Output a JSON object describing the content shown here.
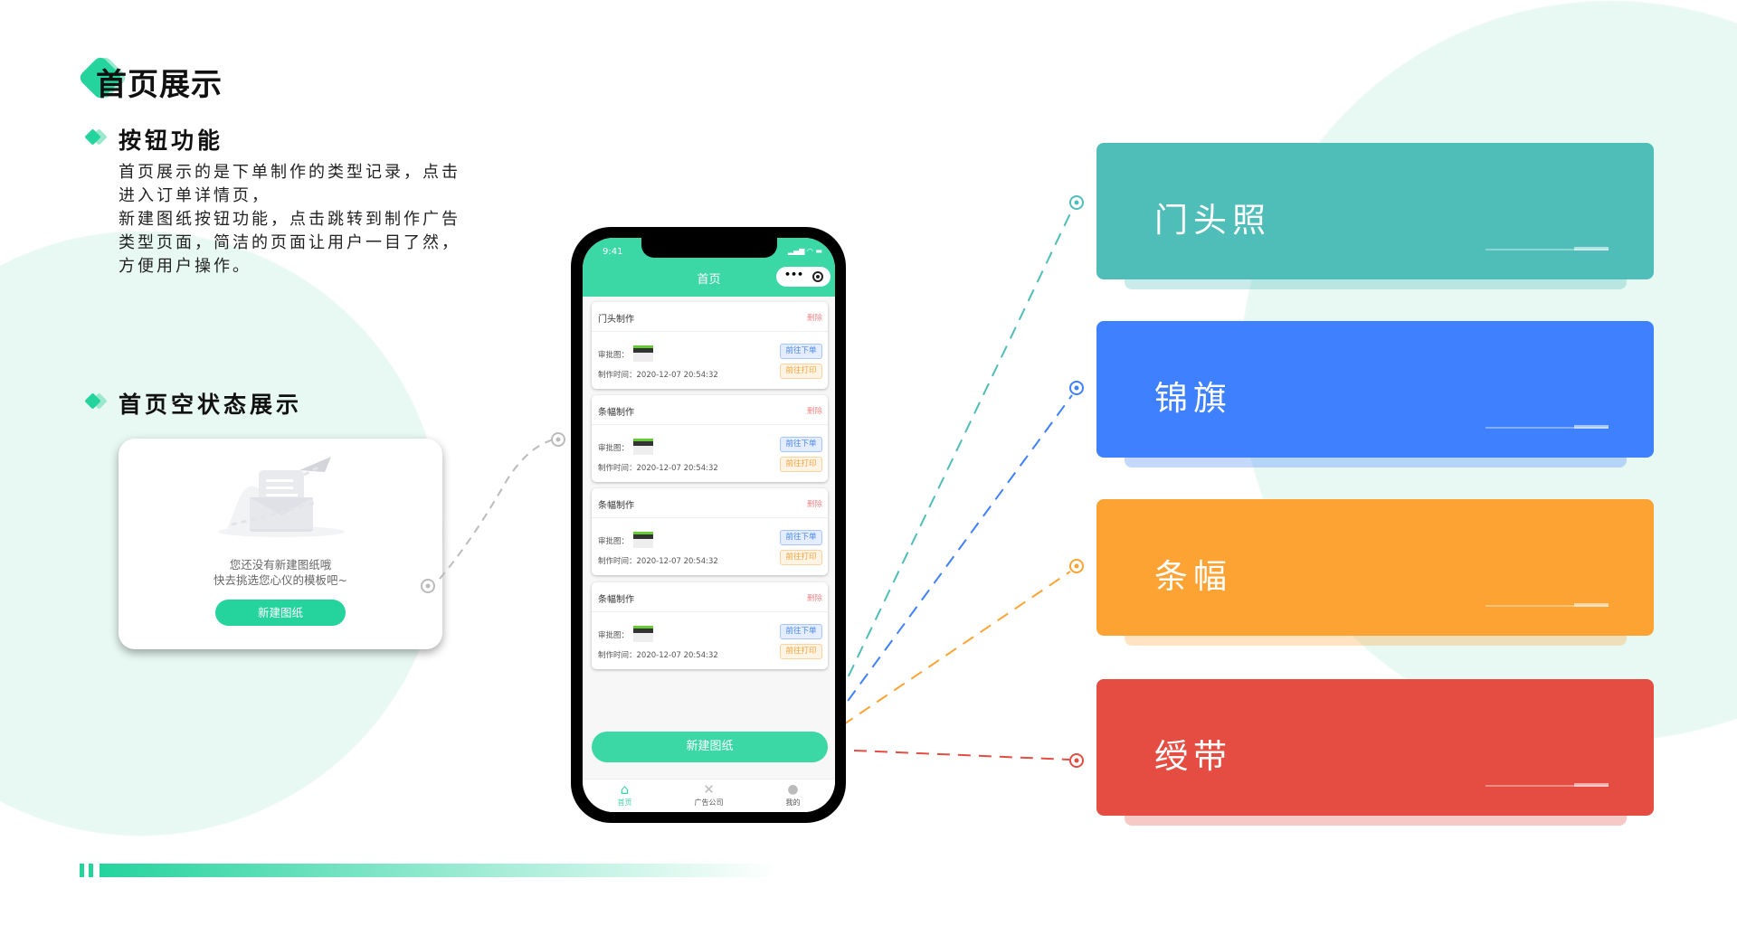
{
  "colors": {
    "accent": "#25d39d",
    "teal": "#4fbdb8",
    "blue": "#3f80fe",
    "orange": "#fca334",
    "red": "#e54c42"
  },
  "page_title": "首页展示",
  "section1": {
    "heading": "按钮功能",
    "paragraph": [
      "首页展示的是下单制作的类型记录，点击进入订单详情页，",
      "新建图纸按钮功能，点击跳转到制作广告类型页面，简洁的页面让用户一目了然，方便用户操作。"
    ]
  },
  "section2": {
    "heading": "首页空状态展示"
  },
  "empty_state": {
    "icon": "envelope-paper-plane-icon",
    "line1": "您还没有新建图纸哦",
    "line2": "快去挑选您心仪的模板吧~",
    "button": "新建图纸"
  },
  "phone": {
    "time": "9:41",
    "nav_title": "首页",
    "menu_icon": "more-dots-icon",
    "close_icon": "target-icon",
    "orders": [
      {
        "title": "门头制作",
        "delete": "删除",
        "image_label": "审批图：",
        "time_label": "制作时间：",
        "time": "2020-12-07  20:54:32",
        "order_btn": "前往下单",
        "print_btn": "前往打印"
      },
      {
        "title": "条幅制作",
        "delete": "删除",
        "image_label": "审批图：",
        "time_label": "制作时间：",
        "time": "2020-12-07  20:54:32",
        "order_btn": "前往下单",
        "print_btn": "前往打印"
      },
      {
        "title": "条幅制作",
        "delete": "删除",
        "image_label": "审批图：",
        "time_label": "制作时间：",
        "time": "2020-12-07  20:54:32",
        "order_btn": "前往下单",
        "print_btn": "前往打印"
      },
      {
        "title": "条幅制作",
        "delete": "删除",
        "image_label": "审批图：",
        "time_label": "制作时间：",
        "time": "2020-12-07  20:54:32",
        "order_btn": "前往下单",
        "print_btn": "前往打印"
      }
    ],
    "new_button": "新建图纸",
    "tabs": [
      {
        "label": "首页",
        "icon": "home-icon",
        "active": true
      },
      {
        "label": "广告公司",
        "icon": "tools-icon",
        "active": false
      },
      {
        "label": "我的",
        "icon": "user-icon",
        "active": false
      }
    ]
  },
  "categories": [
    {
      "label": "门头照",
      "color": "#4fbdb8"
    },
    {
      "label": "锦旗",
      "color": "#3f80fe"
    },
    {
      "label": "条幅",
      "color": "#fca334"
    },
    {
      "label": "绶带",
      "color": "#e54c42"
    }
  ]
}
